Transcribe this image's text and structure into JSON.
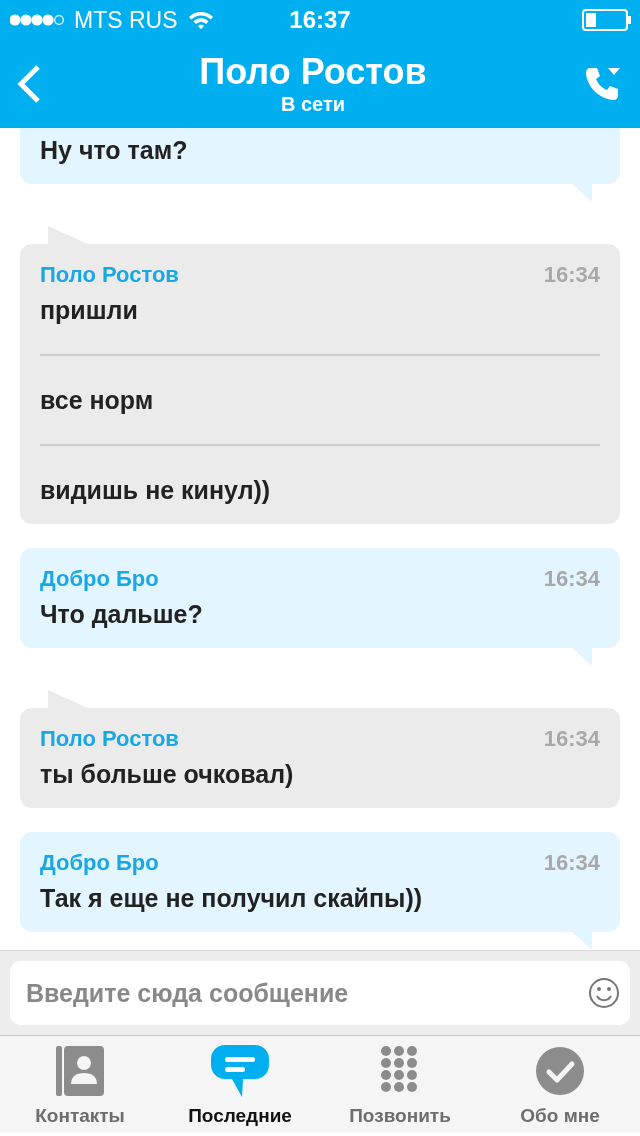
{
  "status_bar": {
    "carrier": "MTS RUS",
    "time": "16:37"
  },
  "header": {
    "title": "Поло Ростов",
    "subtitle": "В сети"
  },
  "messages": [
    {
      "kind": "outgoing",
      "lines": [
        "Ну что там?"
      ]
    },
    {
      "kind": "incoming",
      "sender": "Поло Ростов",
      "time": "16:34",
      "lines": [
        "пришли",
        "все норм",
        "видишь не кинул))"
      ]
    },
    {
      "kind": "outgoing",
      "sender": "Добро Бро",
      "time": "16:34",
      "lines": [
        "Что дальше?"
      ]
    },
    {
      "kind": "incoming",
      "sender": "Поло Ростов",
      "time": "16:34",
      "lines": [
        "ты больше очковал)"
      ]
    },
    {
      "kind": "outgoing",
      "sender": "Добро Бро",
      "time": "16:34",
      "lines": [
        "Так я еще не получил скайпы))"
      ]
    }
  ],
  "composer": {
    "placeholder": "Введите сюда сообщение"
  },
  "tabs": [
    {
      "kind": "contacts",
      "label": "Контакты",
      "selected": false
    },
    {
      "kind": "recent",
      "label": "Последние",
      "selected": true
    },
    {
      "kind": "dialpad",
      "label": "Позвонить",
      "selected": false
    },
    {
      "kind": "profile",
      "label": "Обо мне",
      "selected": false
    }
  ]
}
